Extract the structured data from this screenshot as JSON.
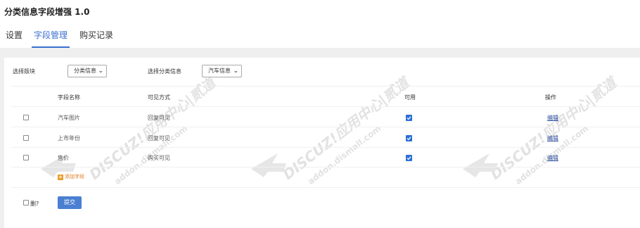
{
  "app": {
    "title": "分类信息字段增强 1.0"
  },
  "tabs": [
    {
      "label": "设置",
      "active": false
    },
    {
      "label": "字段管理",
      "active": true
    },
    {
      "label": "购买记录",
      "active": false
    }
  ],
  "filters": {
    "block_label": "选择版块",
    "block_value": "分类信息",
    "category_label": "选择分类信息",
    "category_value": "汽车信息"
  },
  "table": {
    "headers": {
      "name": "字段名称",
      "visibility": "可见方式",
      "enabled": "可用",
      "actions": "操作"
    },
    "rows": [
      {
        "selected": false,
        "name": "汽车图片",
        "visibility": "回复可见",
        "enabled": true,
        "action": "编辑"
      },
      {
        "selected": false,
        "name": "上市年份",
        "visibility": "回复可见",
        "enabled": true,
        "action": "编辑"
      },
      {
        "selected": false,
        "name": "售价",
        "visibility": "购买可见",
        "enabled": true,
        "action": "编辑"
      }
    ],
    "add_field": "添加字段"
  },
  "footer": {
    "delete_label": "删?",
    "submit_label": "提交"
  },
  "watermark": {
    "text": "DISCUZ!应用中心|贰道",
    "url": "addon.dismall.com"
  },
  "colors": {
    "accent": "#3b6fd0",
    "checkbox": "#2c6fd6",
    "submit": "#4a7fd1",
    "add_link": "#e07b1a"
  }
}
